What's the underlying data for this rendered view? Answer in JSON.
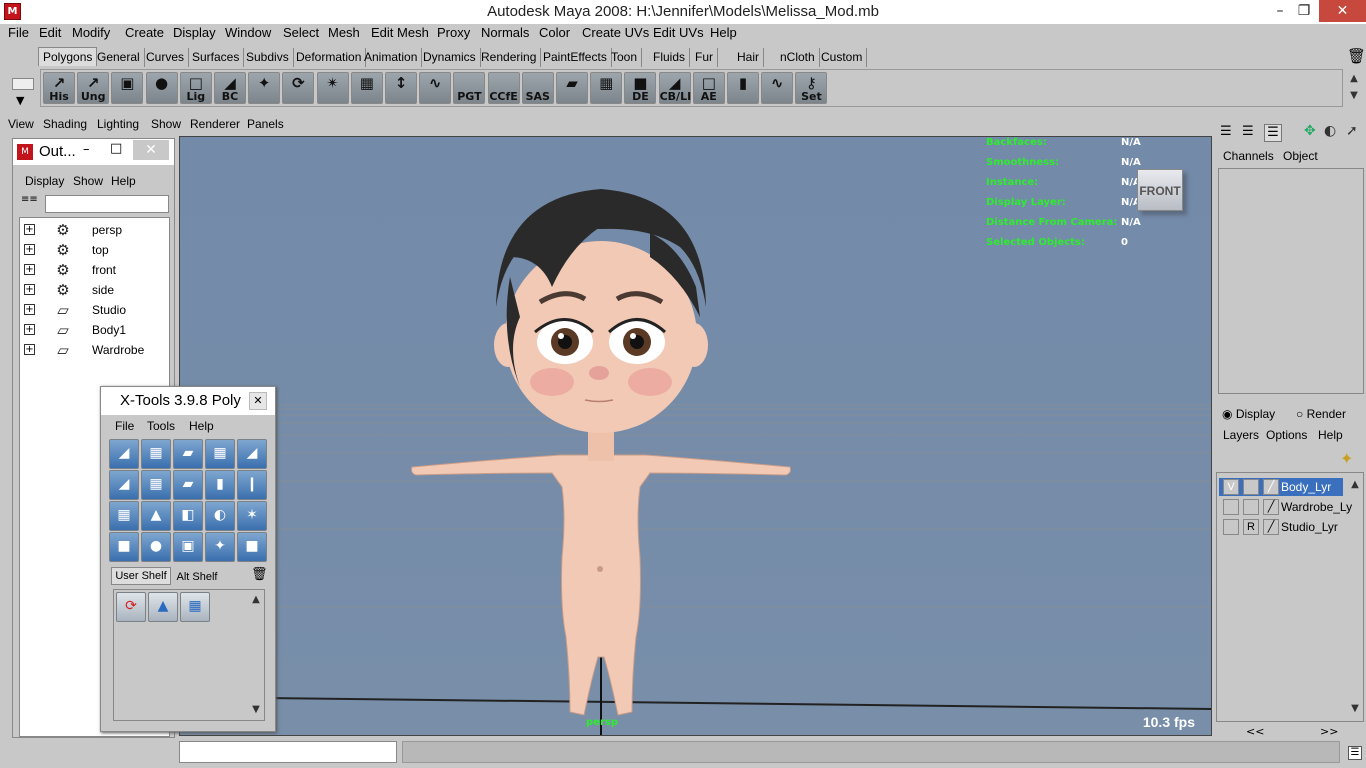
{
  "window": {
    "title": "Autodesk Maya 2008: H:\\Jennifer\\Models\\Melissa_Mod.mb",
    "minimize": "–",
    "maximize": "❐",
    "close": "✕"
  },
  "menubar": [
    "File",
    "Edit",
    "Modify",
    "Create",
    "Display",
    "Window",
    "Select",
    "Mesh",
    "Edit Mesh",
    "Proxy",
    "Normals",
    "Color",
    "Create UVs",
    "Edit UVs",
    "Help"
  ],
  "shelf_tabs": [
    "Polygons",
    "General",
    "Curves",
    "Surfaces",
    "Subdivs",
    "Deformation",
    "Animation",
    "Dynamics",
    "Rendering",
    "PaintEffects",
    "Toon",
    "Fluids",
    "Fur",
    "Hair",
    "nCloth",
    "Custom"
  ],
  "shelf_active_tab": "Polygons",
  "shelf_buttons": [
    {
      "label": "His",
      "icon": "history-icon"
    },
    {
      "label": "Ung",
      "icon": "ungroup-icon"
    },
    {
      "label": "",
      "icon": "cube-stack-icon"
    },
    {
      "label": "",
      "icon": "sphere-icon"
    },
    {
      "label": "Lig",
      "icon": "light-icon"
    },
    {
      "label": "BC",
      "icon": "bake-icon"
    },
    {
      "label": "",
      "icon": "manipulator-icon"
    },
    {
      "label": "",
      "icon": "rotate-tool-icon"
    },
    {
      "label": "",
      "icon": "sculpt-icon"
    },
    {
      "label": "",
      "icon": "uv-grid-icon"
    },
    {
      "label": "",
      "icon": "move-axis-icon"
    },
    {
      "label": "",
      "icon": "curve-icon"
    },
    {
      "label": "PGT",
      "icon": "pgt-icon"
    },
    {
      "label": "CCfE",
      "icon": "ccfe-icon"
    },
    {
      "label": "SAS",
      "icon": "sas-icon"
    },
    {
      "label": "",
      "icon": "plane-icon"
    },
    {
      "label": "",
      "icon": "uv-layout-icon"
    },
    {
      "label": "DE",
      "icon": "delete-edge-icon"
    },
    {
      "label": "CB/LI",
      "icon": "cb-li-icon"
    },
    {
      "label": "AE",
      "icon": "attribute-editor-icon"
    },
    {
      "label": "",
      "icon": "cylinder-icon"
    },
    {
      "label": "",
      "icon": "path-icon"
    },
    {
      "label": "Set",
      "icon": "set-key-icon"
    }
  ],
  "panel_menu": [
    "View",
    "Shading",
    "Lighting",
    "Show",
    "Renderer",
    "Panels"
  ],
  "outliner": {
    "title": "Out...",
    "menu": [
      "Display",
      "Show",
      "Help"
    ],
    "filter_value": "",
    "items": [
      {
        "name": "persp",
        "icon": "camera-icon"
      },
      {
        "name": "top",
        "icon": "camera-icon"
      },
      {
        "name": "front",
        "icon": "camera-icon"
      },
      {
        "name": "side",
        "icon": "camera-icon"
      },
      {
        "name": "Studio",
        "icon": "transform-icon"
      },
      {
        "name": "Body1",
        "icon": "transform-icon"
      },
      {
        "name": "Wardrobe",
        "icon": "transform-icon"
      }
    ]
  },
  "viewport": {
    "hud": [
      {
        "label": "Backfaces:",
        "value": "N/A"
      },
      {
        "label": "Smoothness:",
        "value": "N/A"
      },
      {
        "label": "Instance:",
        "value": "N/A"
      },
      {
        "label": "Display Layer:",
        "value": "N/A"
      },
      {
        "label": "Distance From Camera:",
        "value": "N/A"
      },
      {
        "label": "Selected Objects:",
        "value": "0"
      }
    ],
    "view_cube": "FRONT",
    "fps": "10.3 fps",
    "camera": "persp",
    "colors": {
      "background": "#758ca9",
      "hud": "#2eec2e",
      "skin": "#f2c9b4",
      "hair": "#2a2a2a"
    }
  },
  "xtools": {
    "title": "X-Tools 3.9.8 Poly",
    "menu": [
      "File",
      "Tools",
      "Help"
    ],
    "tabs": [
      "User Shelf",
      "Alt Shelf"
    ]
  },
  "channel_box": {
    "tabs": [
      "Channels",
      "Object"
    ]
  },
  "layer_editor": {
    "modes": [
      "Display",
      "Render"
    ],
    "selected_mode": "Display",
    "menu": [
      "Layers",
      "Options",
      "Help"
    ],
    "layers": [
      {
        "name": "Body_Lyr",
        "vis": "V",
        "type": "",
        "selected": true
      },
      {
        "name": "Wardrobe_Ly",
        "vis": "",
        "type": "",
        "selected": false
      },
      {
        "name": "Studio_Lyr",
        "vis": "",
        "type": "R",
        "selected": false
      }
    ],
    "nav": [
      "<<",
      ">>"
    ]
  }
}
